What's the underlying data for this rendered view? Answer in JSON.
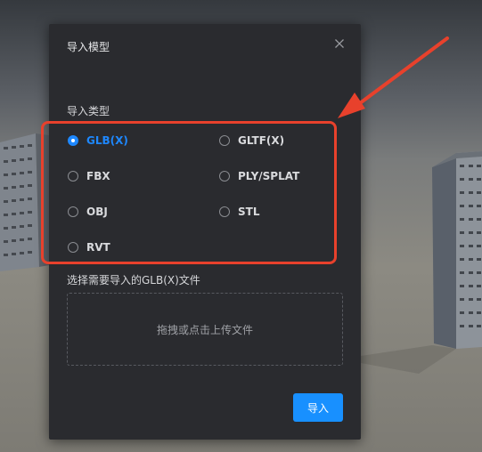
{
  "dialog": {
    "title": "导入模型",
    "close_icon": "close-icon",
    "type_section_label": "导入类型",
    "options": [
      {
        "label": "GLB(X)",
        "checked": true
      },
      {
        "label": "GLTF(X)",
        "checked": false
      },
      {
        "label": "FBX",
        "checked": false
      },
      {
        "label": "PLY/SPLAT",
        "checked": false
      },
      {
        "label": "OBJ",
        "checked": false
      },
      {
        "label": "STL",
        "checked": false
      },
      {
        "label": "RVT",
        "checked": false
      }
    ],
    "file_label": "选择需要导入的GLB(X)文件",
    "dropzone_text": "拖拽或点击上传文件",
    "import_button": "导入"
  },
  "colors": {
    "accent": "#1890ff",
    "dialog_bg": "#2a2b2f",
    "annotation": "#e8412c"
  }
}
